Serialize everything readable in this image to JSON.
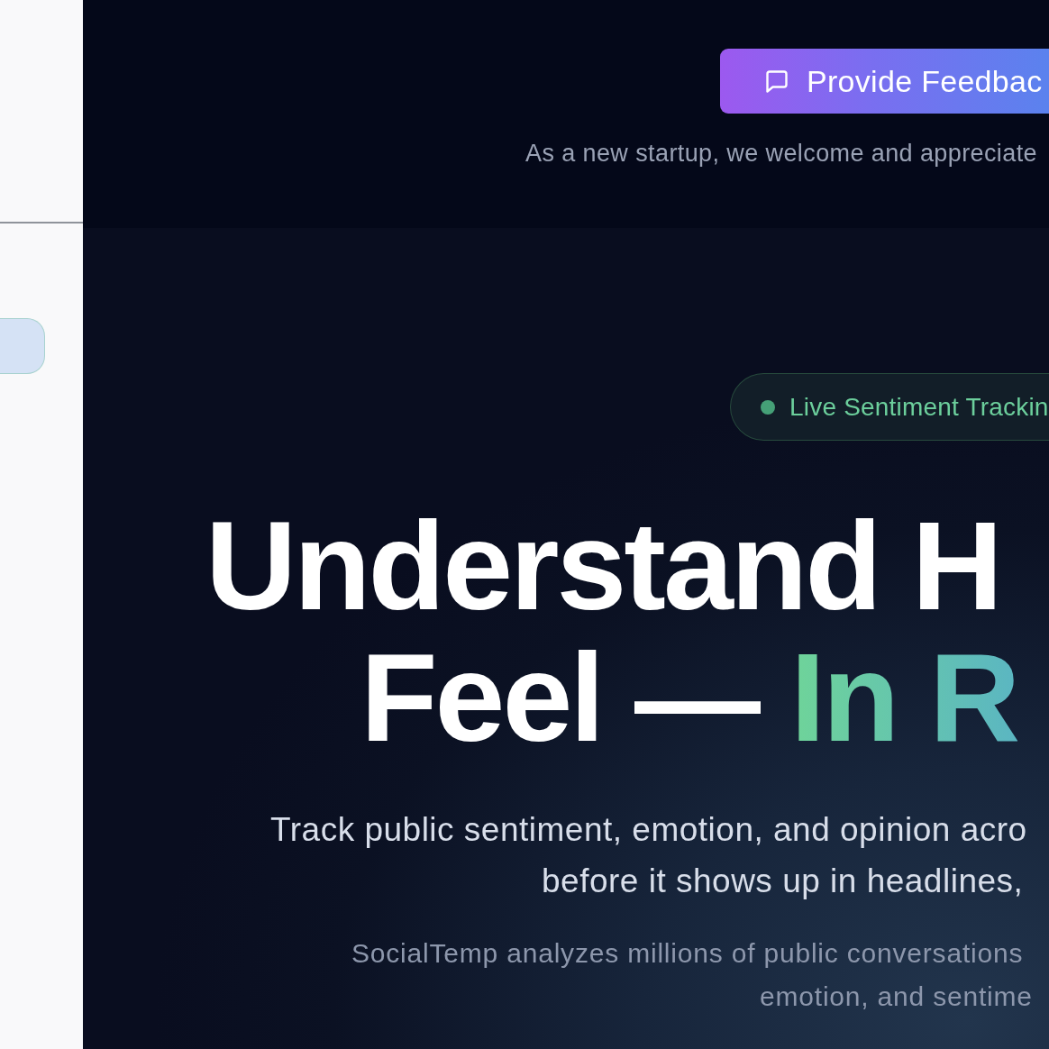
{
  "feedback": {
    "button": "Provide Feedbac",
    "note": "As a new startup, we welcome and appreciate"
  },
  "hero": {
    "badge": "Live Sentiment Trackin",
    "headline": {
      "lines": [
        "Understand H",
        "Feel — "
      ],
      "accent": "In R"
    },
    "tagline": [
      "Track public sentiment, emotion, and opinion acro",
      "before it shows up in headlines,"
    ],
    "description": [
      "SocialTemp analyzes millions of public conversations",
      "emotion, and sentime"
    ]
  }
}
